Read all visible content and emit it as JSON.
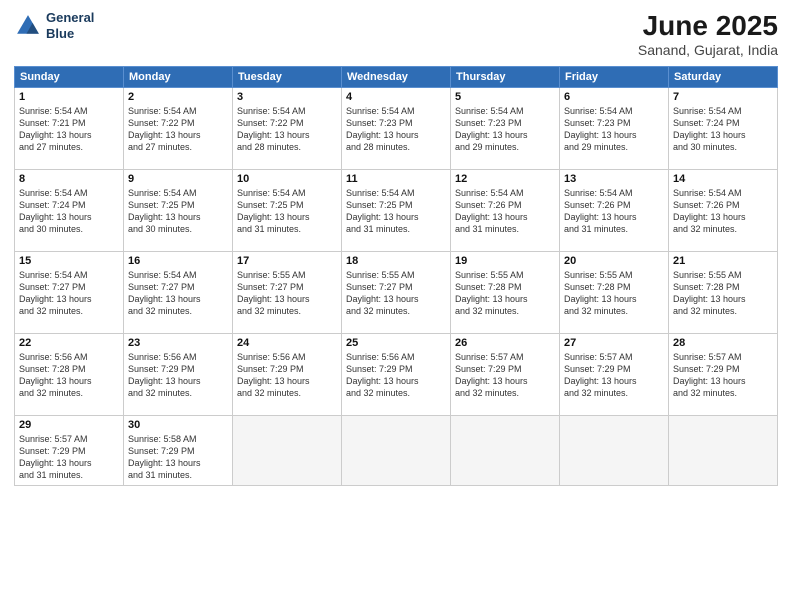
{
  "logo": {
    "line1": "General",
    "line2": "Blue"
  },
  "title": "June 2025",
  "subtitle": "Sanand, Gujarat, India",
  "headers": [
    "Sunday",
    "Monday",
    "Tuesday",
    "Wednesday",
    "Thursday",
    "Friday",
    "Saturday"
  ],
  "weeks": [
    [
      {
        "day": "1",
        "lines": [
          "Sunrise: 5:54 AM",
          "Sunset: 7:21 PM",
          "Daylight: 13 hours",
          "and 27 minutes."
        ]
      },
      {
        "day": "2",
        "lines": [
          "Sunrise: 5:54 AM",
          "Sunset: 7:22 PM",
          "Daylight: 13 hours",
          "and 27 minutes."
        ]
      },
      {
        "day": "3",
        "lines": [
          "Sunrise: 5:54 AM",
          "Sunset: 7:22 PM",
          "Daylight: 13 hours",
          "and 28 minutes."
        ]
      },
      {
        "day": "4",
        "lines": [
          "Sunrise: 5:54 AM",
          "Sunset: 7:23 PM",
          "Daylight: 13 hours",
          "and 28 minutes."
        ]
      },
      {
        "day": "5",
        "lines": [
          "Sunrise: 5:54 AM",
          "Sunset: 7:23 PM",
          "Daylight: 13 hours",
          "and 29 minutes."
        ]
      },
      {
        "day": "6",
        "lines": [
          "Sunrise: 5:54 AM",
          "Sunset: 7:23 PM",
          "Daylight: 13 hours",
          "and 29 minutes."
        ]
      },
      {
        "day": "7",
        "lines": [
          "Sunrise: 5:54 AM",
          "Sunset: 7:24 PM",
          "Daylight: 13 hours",
          "and 30 minutes."
        ]
      }
    ],
    [
      {
        "day": "8",
        "lines": [
          "Sunrise: 5:54 AM",
          "Sunset: 7:24 PM",
          "Daylight: 13 hours",
          "and 30 minutes."
        ]
      },
      {
        "day": "9",
        "lines": [
          "Sunrise: 5:54 AM",
          "Sunset: 7:25 PM",
          "Daylight: 13 hours",
          "and 30 minutes."
        ]
      },
      {
        "day": "10",
        "lines": [
          "Sunrise: 5:54 AM",
          "Sunset: 7:25 PM",
          "Daylight: 13 hours",
          "and 31 minutes."
        ]
      },
      {
        "day": "11",
        "lines": [
          "Sunrise: 5:54 AM",
          "Sunset: 7:25 PM",
          "Daylight: 13 hours",
          "and 31 minutes."
        ]
      },
      {
        "day": "12",
        "lines": [
          "Sunrise: 5:54 AM",
          "Sunset: 7:26 PM",
          "Daylight: 13 hours",
          "and 31 minutes."
        ]
      },
      {
        "day": "13",
        "lines": [
          "Sunrise: 5:54 AM",
          "Sunset: 7:26 PM",
          "Daylight: 13 hours",
          "and 31 minutes."
        ]
      },
      {
        "day": "14",
        "lines": [
          "Sunrise: 5:54 AM",
          "Sunset: 7:26 PM",
          "Daylight: 13 hours",
          "and 32 minutes."
        ]
      }
    ],
    [
      {
        "day": "15",
        "lines": [
          "Sunrise: 5:54 AM",
          "Sunset: 7:27 PM",
          "Daylight: 13 hours",
          "and 32 minutes."
        ]
      },
      {
        "day": "16",
        "lines": [
          "Sunrise: 5:54 AM",
          "Sunset: 7:27 PM",
          "Daylight: 13 hours",
          "and 32 minutes."
        ]
      },
      {
        "day": "17",
        "lines": [
          "Sunrise: 5:55 AM",
          "Sunset: 7:27 PM",
          "Daylight: 13 hours",
          "and 32 minutes."
        ]
      },
      {
        "day": "18",
        "lines": [
          "Sunrise: 5:55 AM",
          "Sunset: 7:27 PM",
          "Daylight: 13 hours",
          "and 32 minutes."
        ]
      },
      {
        "day": "19",
        "lines": [
          "Sunrise: 5:55 AM",
          "Sunset: 7:28 PM",
          "Daylight: 13 hours",
          "and 32 minutes."
        ]
      },
      {
        "day": "20",
        "lines": [
          "Sunrise: 5:55 AM",
          "Sunset: 7:28 PM",
          "Daylight: 13 hours",
          "and 32 minutes."
        ]
      },
      {
        "day": "21",
        "lines": [
          "Sunrise: 5:55 AM",
          "Sunset: 7:28 PM",
          "Daylight: 13 hours",
          "and 32 minutes."
        ]
      }
    ],
    [
      {
        "day": "22",
        "lines": [
          "Sunrise: 5:56 AM",
          "Sunset: 7:28 PM",
          "Daylight: 13 hours",
          "and 32 minutes."
        ]
      },
      {
        "day": "23",
        "lines": [
          "Sunrise: 5:56 AM",
          "Sunset: 7:29 PM",
          "Daylight: 13 hours",
          "and 32 minutes."
        ]
      },
      {
        "day": "24",
        "lines": [
          "Sunrise: 5:56 AM",
          "Sunset: 7:29 PM",
          "Daylight: 13 hours",
          "and 32 minutes."
        ]
      },
      {
        "day": "25",
        "lines": [
          "Sunrise: 5:56 AM",
          "Sunset: 7:29 PM",
          "Daylight: 13 hours",
          "and 32 minutes."
        ]
      },
      {
        "day": "26",
        "lines": [
          "Sunrise: 5:57 AM",
          "Sunset: 7:29 PM",
          "Daylight: 13 hours",
          "and 32 minutes."
        ]
      },
      {
        "day": "27",
        "lines": [
          "Sunrise: 5:57 AM",
          "Sunset: 7:29 PM",
          "Daylight: 13 hours",
          "and 32 minutes."
        ]
      },
      {
        "day": "28",
        "lines": [
          "Sunrise: 5:57 AM",
          "Sunset: 7:29 PM",
          "Daylight: 13 hours",
          "and 32 minutes."
        ]
      }
    ],
    [
      {
        "day": "29",
        "lines": [
          "Sunrise: 5:57 AM",
          "Sunset: 7:29 PM",
          "Daylight: 13 hours",
          "and 31 minutes."
        ]
      },
      {
        "day": "30",
        "lines": [
          "Sunrise: 5:58 AM",
          "Sunset: 7:29 PM",
          "Daylight: 13 hours",
          "and 31 minutes."
        ]
      },
      {
        "day": "",
        "lines": []
      },
      {
        "day": "",
        "lines": []
      },
      {
        "day": "",
        "lines": []
      },
      {
        "day": "",
        "lines": []
      },
      {
        "day": "",
        "lines": []
      }
    ]
  ]
}
